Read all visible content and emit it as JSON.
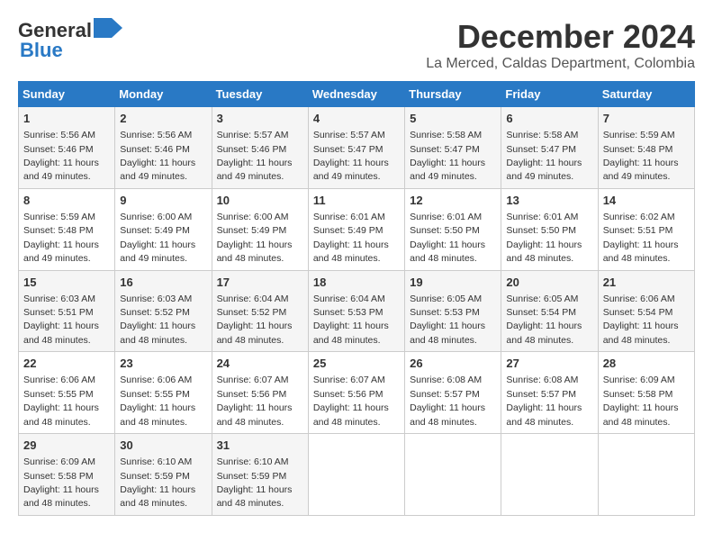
{
  "header": {
    "logo_general": "General",
    "logo_blue": "Blue",
    "month": "December 2024",
    "location": "La Merced, Caldas Department, Colombia"
  },
  "days_of_week": [
    "Sunday",
    "Monday",
    "Tuesday",
    "Wednesday",
    "Thursday",
    "Friday",
    "Saturday"
  ],
  "weeks": [
    [
      {
        "day": "1",
        "sunrise": "5:56 AM",
        "sunset": "5:46 PM",
        "daylight": "11 hours and 49 minutes."
      },
      {
        "day": "2",
        "sunrise": "5:56 AM",
        "sunset": "5:46 PM",
        "daylight": "11 hours and 49 minutes."
      },
      {
        "day": "3",
        "sunrise": "5:57 AM",
        "sunset": "5:46 PM",
        "daylight": "11 hours and 49 minutes."
      },
      {
        "day": "4",
        "sunrise": "5:57 AM",
        "sunset": "5:47 PM",
        "daylight": "11 hours and 49 minutes."
      },
      {
        "day": "5",
        "sunrise": "5:58 AM",
        "sunset": "5:47 PM",
        "daylight": "11 hours and 49 minutes."
      },
      {
        "day": "6",
        "sunrise": "5:58 AM",
        "sunset": "5:47 PM",
        "daylight": "11 hours and 49 minutes."
      },
      {
        "day": "7",
        "sunrise": "5:59 AM",
        "sunset": "5:48 PM",
        "daylight": "11 hours and 49 minutes."
      }
    ],
    [
      {
        "day": "8",
        "sunrise": "5:59 AM",
        "sunset": "5:48 PM",
        "daylight": "11 hours and 49 minutes."
      },
      {
        "day": "9",
        "sunrise": "6:00 AM",
        "sunset": "5:49 PM",
        "daylight": "11 hours and 49 minutes."
      },
      {
        "day": "10",
        "sunrise": "6:00 AM",
        "sunset": "5:49 PM",
        "daylight": "11 hours and 48 minutes."
      },
      {
        "day": "11",
        "sunrise": "6:01 AM",
        "sunset": "5:49 PM",
        "daylight": "11 hours and 48 minutes."
      },
      {
        "day": "12",
        "sunrise": "6:01 AM",
        "sunset": "5:50 PM",
        "daylight": "11 hours and 48 minutes."
      },
      {
        "day": "13",
        "sunrise": "6:01 AM",
        "sunset": "5:50 PM",
        "daylight": "11 hours and 48 minutes."
      },
      {
        "day": "14",
        "sunrise": "6:02 AM",
        "sunset": "5:51 PM",
        "daylight": "11 hours and 48 minutes."
      }
    ],
    [
      {
        "day": "15",
        "sunrise": "6:03 AM",
        "sunset": "5:51 PM",
        "daylight": "11 hours and 48 minutes."
      },
      {
        "day": "16",
        "sunrise": "6:03 AM",
        "sunset": "5:52 PM",
        "daylight": "11 hours and 48 minutes."
      },
      {
        "day": "17",
        "sunrise": "6:04 AM",
        "sunset": "5:52 PM",
        "daylight": "11 hours and 48 minutes."
      },
      {
        "day": "18",
        "sunrise": "6:04 AM",
        "sunset": "5:53 PM",
        "daylight": "11 hours and 48 minutes."
      },
      {
        "day": "19",
        "sunrise": "6:05 AM",
        "sunset": "5:53 PM",
        "daylight": "11 hours and 48 minutes."
      },
      {
        "day": "20",
        "sunrise": "6:05 AM",
        "sunset": "5:54 PM",
        "daylight": "11 hours and 48 minutes."
      },
      {
        "day": "21",
        "sunrise": "6:06 AM",
        "sunset": "5:54 PM",
        "daylight": "11 hours and 48 minutes."
      }
    ],
    [
      {
        "day": "22",
        "sunrise": "6:06 AM",
        "sunset": "5:55 PM",
        "daylight": "11 hours and 48 minutes."
      },
      {
        "day": "23",
        "sunrise": "6:06 AM",
        "sunset": "5:55 PM",
        "daylight": "11 hours and 48 minutes."
      },
      {
        "day": "24",
        "sunrise": "6:07 AM",
        "sunset": "5:56 PM",
        "daylight": "11 hours and 48 minutes."
      },
      {
        "day": "25",
        "sunrise": "6:07 AM",
        "sunset": "5:56 PM",
        "daylight": "11 hours and 48 minutes."
      },
      {
        "day": "26",
        "sunrise": "6:08 AM",
        "sunset": "5:57 PM",
        "daylight": "11 hours and 48 minutes."
      },
      {
        "day": "27",
        "sunrise": "6:08 AM",
        "sunset": "5:57 PM",
        "daylight": "11 hours and 48 minutes."
      },
      {
        "day": "28",
        "sunrise": "6:09 AM",
        "sunset": "5:58 PM",
        "daylight": "11 hours and 48 minutes."
      }
    ],
    [
      {
        "day": "29",
        "sunrise": "6:09 AM",
        "sunset": "5:58 PM",
        "daylight": "11 hours and 48 minutes."
      },
      {
        "day": "30",
        "sunrise": "6:10 AM",
        "sunset": "5:59 PM",
        "daylight": "11 hours and 48 minutes."
      },
      {
        "day": "31",
        "sunrise": "6:10 AM",
        "sunset": "5:59 PM",
        "daylight": "11 hours and 48 minutes."
      },
      null,
      null,
      null,
      null
    ]
  ],
  "labels": {
    "sunrise": "Sunrise:",
    "sunset": "Sunset:",
    "daylight": "Daylight:"
  }
}
